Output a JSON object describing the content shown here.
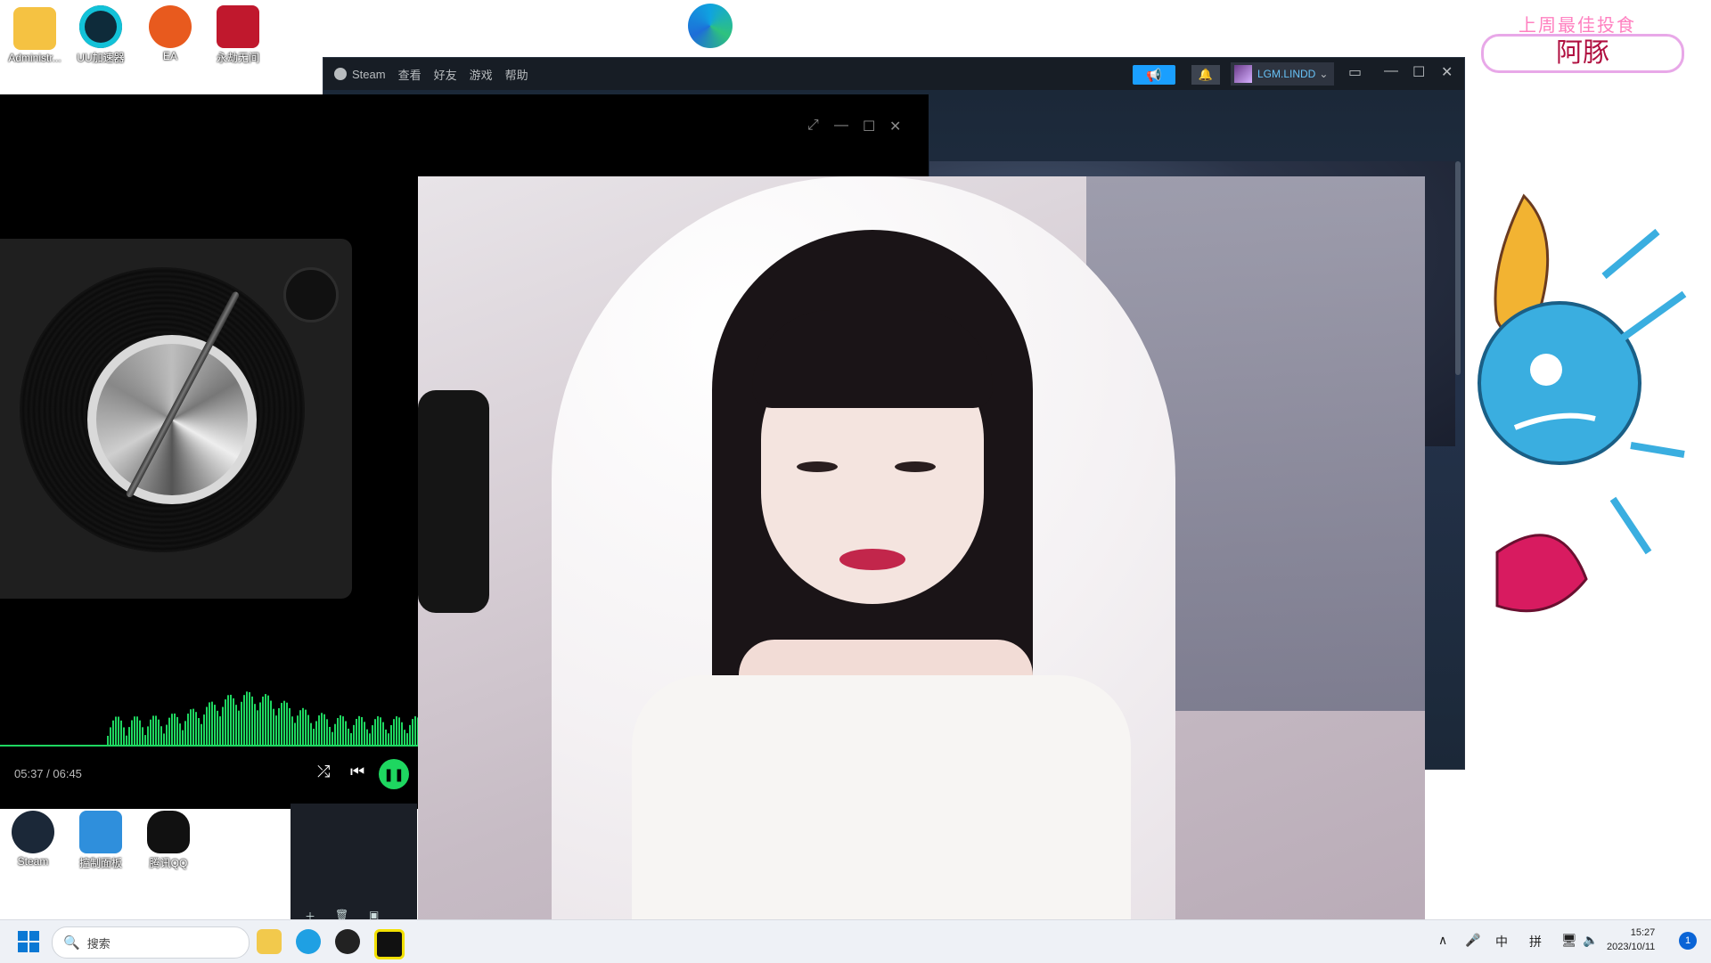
{
  "desktop": {
    "icons_top": [
      {
        "label": "Administr...",
        "color": "#f5c242"
      },
      {
        "label": "UU加速器",
        "color": "#0e2b3a"
      },
      {
        "label": "EA",
        "color": "#e85a1e"
      },
      {
        "label": "永劫无间",
        "color": "#c0182d"
      }
    ],
    "icons_bottom": [
      {
        "label": "Steam",
        "color": "#1b2838"
      },
      {
        "label": "控制面板",
        "color": "#2f8fdc"
      },
      {
        "label": "腾讯QQ",
        "color": "#111111"
      }
    ],
    "badge": {
      "top_text": "上周最佳投食",
      "name": "阿豚"
    }
  },
  "steam": {
    "menu": [
      "Steam",
      "查看",
      "好友",
      "游戏",
      "帮助"
    ],
    "username": "LGM.LINDD",
    "colors": {
      "accent": "#1a9fff",
      "bg": "#171d25"
    }
  },
  "player": {
    "time": "05:37 / 06:45",
    "icons": [
      "fullscreen-icon",
      "minimize-icon",
      "maximize-icon",
      "close-icon",
      "shuffle-icon",
      "previous-icon",
      "pause-icon"
    ],
    "progress": 0.833,
    "accent": "#1ed760"
  },
  "taskbar": {
    "search_placeholder": "搜索",
    "tray": {
      "ime1": "中",
      "ime2": "拼",
      "time": "15:27",
      "date": "2023/10/11",
      "notif_count": "1"
    }
  }
}
